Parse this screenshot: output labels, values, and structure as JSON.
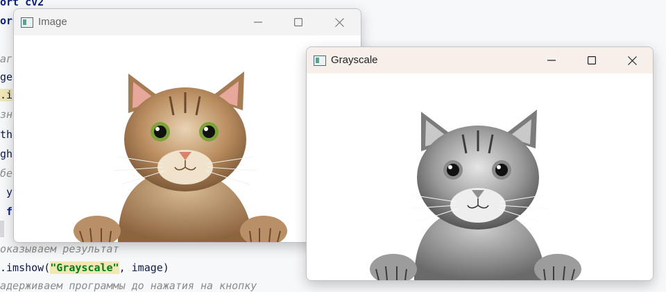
{
  "editor": {
    "lines": [
      {
        "text": "ort cv2"
      },
      {
        "text": "or"
      },
      {
        "text": "аг"
      },
      {
        "text": "ge"
      },
      {
        "text": ".i"
      },
      {
        "text": "зн"
      },
      {
        "text": "th"
      },
      {
        "text": "gh"
      },
      {
        "text": "бе"
      },
      {
        "text": " y"
      },
      {
        "text": " f"
      },
      {
        "text": "оказываем результат"
      },
      {
        "prefix": ".imshow(",
        "string": "\"Grayscale\"",
        "suffix": ", image)"
      },
      {
        "text": "адерживаем программы до нажатия на кнопку"
      }
    ]
  },
  "windows": {
    "image": {
      "title": "Image",
      "state": "inactive"
    },
    "grayscale": {
      "title": "Grayscale",
      "state": "active"
    }
  },
  "controls": {
    "minimize": "minimize-icon",
    "maximize": "maximize-icon",
    "close": "close-icon"
  },
  "colors": {
    "active_titlebar": "#f6efea",
    "inactive_titlebar": "#f3f3f3",
    "string": "#067d17"
  }
}
